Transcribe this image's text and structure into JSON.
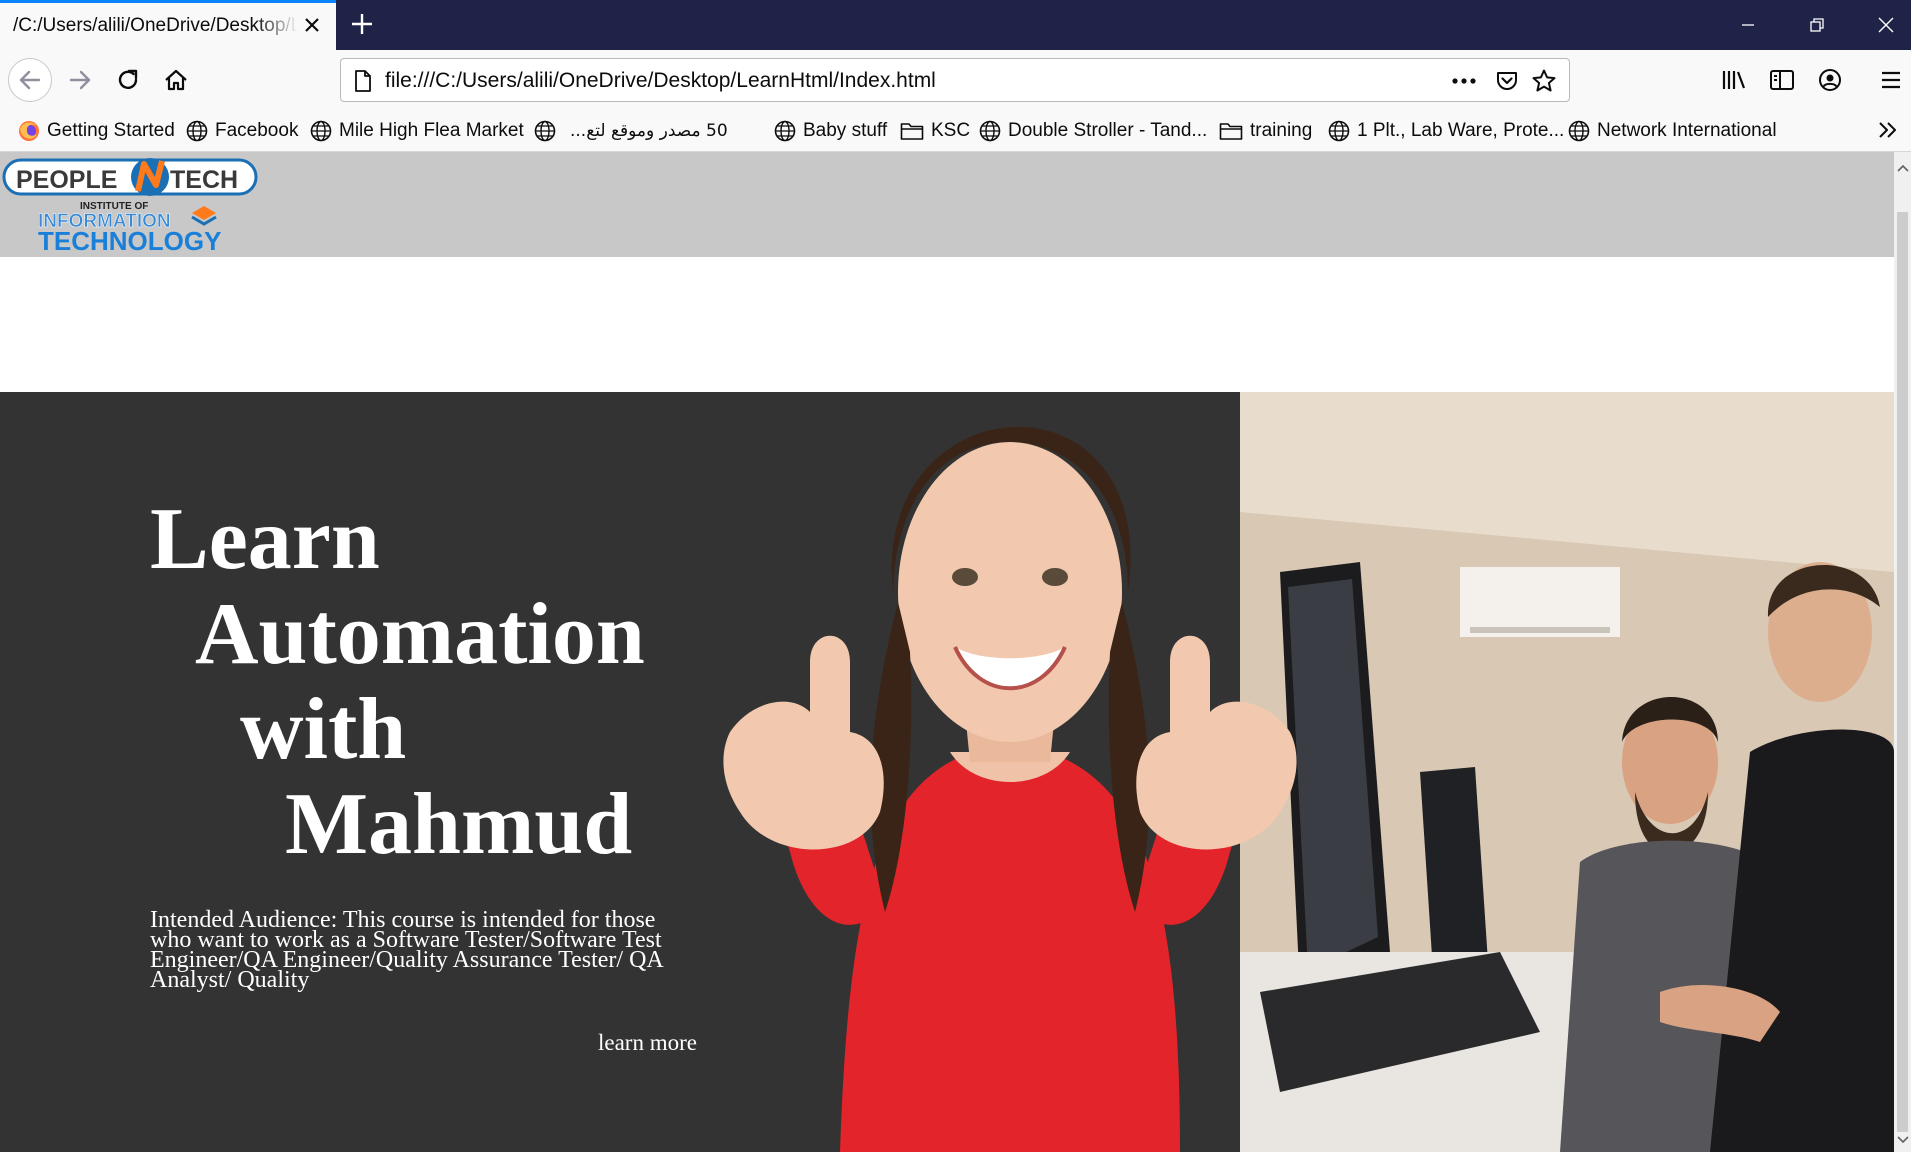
{
  "browser": {
    "tab_title": "/C:/Users/alili/OneDrive/Desktop/LearnHtml/Index.html",
    "url": "file:///C:/Users/alili/OneDrive/Desktop/LearnHtml/Index.html",
    "accent_color": "#0a84ff",
    "titlebar_color": "#1e2347"
  },
  "bookmarks": [
    {
      "label": "Getting Started",
      "icon": "firefox-icon"
    },
    {
      "label": "Facebook",
      "icon": "globe-icon"
    },
    {
      "label": "Mile High Flea Market",
      "icon": "globe-icon"
    },
    {
      "label": "50 مصدر وموقع لتع...",
      "icon": "globe-icon"
    },
    {
      "label": "Baby stuff",
      "icon": "globe-icon"
    },
    {
      "label": "KSC",
      "icon": "folder-icon"
    },
    {
      "label": "Double Stroller - Tand...",
      "icon": "globe-icon"
    },
    {
      "label": "training",
      "icon": "folder-icon"
    },
    {
      "label": "1 Plt., Lab Ware, Prote...",
      "icon": "globe-icon"
    },
    {
      "label": "Network International",
      "icon": "globe-icon"
    }
  ],
  "page": {
    "logo": {
      "brand_left": "PEOPLE",
      "brand_right": "TECH",
      "tagline_small": "INSTITUTE OF",
      "tagline_line1": "INFORMATION",
      "tagline_line2": "TECHNOLOGY"
    },
    "headline": [
      "Learn",
      "Automation",
      "with",
      "Mahmud"
    ],
    "audience_text": "Intended Audience: This course is intended for those who want to work as a Software Tester/Software Test Engineer/QA Engineer/Quality Assurance Tester/ QA Analyst/ Quality",
    "learn_more_label": "learn more",
    "colors": {
      "header_band": "#c8c8c8",
      "hero_background": "#333333",
      "shirt_red": "#e3242b"
    }
  }
}
